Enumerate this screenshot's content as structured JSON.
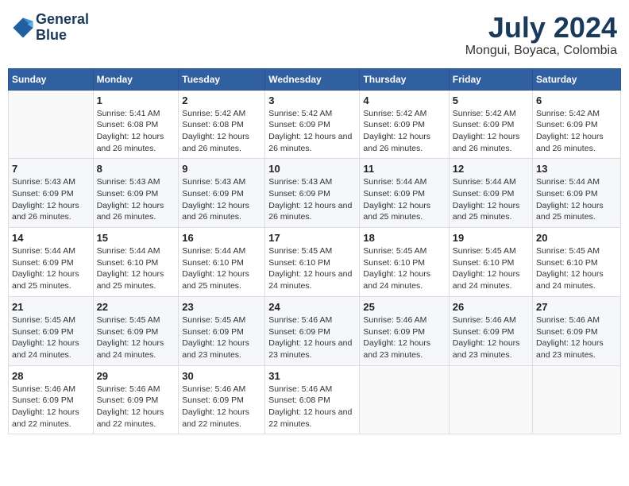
{
  "header": {
    "logo_line1": "General",
    "logo_line2": "Blue",
    "month_year": "July 2024",
    "location": "Mongui, Boyaca, Colombia"
  },
  "days_of_week": [
    "Sunday",
    "Monday",
    "Tuesday",
    "Wednesday",
    "Thursday",
    "Friday",
    "Saturday"
  ],
  "weeks": [
    [
      {
        "day": "",
        "sunrise": "",
        "sunset": "",
        "daylight": ""
      },
      {
        "day": "1",
        "sunrise": "Sunrise: 5:41 AM",
        "sunset": "Sunset: 6:08 PM",
        "daylight": "Daylight: 12 hours and 26 minutes."
      },
      {
        "day": "2",
        "sunrise": "Sunrise: 5:42 AM",
        "sunset": "Sunset: 6:08 PM",
        "daylight": "Daylight: 12 hours and 26 minutes."
      },
      {
        "day": "3",
        "sunrise": "Sunrise: 5:42 AM",
        "sunset": "Sunset: 6:09 PM",
        "daylight": "Daylight: 12 hours and 26 minutes."
      },
      {
        "day": "4",
        "sunrise": "Sunrise: 5:42 AM",
        "sunset": "Sunset: 6:09 PM",
        "daylight": "Daylight: 12 hours and 26 minutes."
      },
      {
        "day": "5",
        "sunrise": "Sunrise: 5:42 AM",
        "sunset": "Sunset: 6:09 PM",
        "daylight": "Daylight: 12 hours and 26 minutes."
      },
      {
        "day": "6",
        "sunrise": "Sunrise: 5:42 AM",
        "sunset": "Sunset: 6:09 PM",
        "daylight": "Daylight: 12 hours and 26 minutes."
      }
    ],
    [
      {
        "day": "7",
        "sunrise": "Sunrise: 5:43 AM",
        "sunset": "Sunset: 6:09 PM",
        "daylight": "Daylight: 12 hours and 26 minutes."
      },
      {
        "day": "8",
        "sunrise": "Sunrise: 5:43 AM",
        "sunset": "Sunset: 6:09 PM",
        "daylight": "Daylight: 12 hours and 26 minutes."
      },
      {
        "day": "9",
        "sunrise": "Sunrise: 5:43 AM",
        "sunset": "Sunset: 6:09 PM",
        "daylight": "Daylight: 12 hours and 26 minutes."
      },
      {
        "day": "10",
        "sunrise": "Sunrise: 5:43 AM",
        "sunset": "Sunset: 6:09 PM",
        "daylight": "Daylight: 12 hours and 26 minutes."
      },
      {
        "day": "11",
        "sunrise": "Sunrise: 5:44 AM",
        "sunset": "Sunset: 6:09 PM",
        "daylight": "Daylight: 12 hours and 25 minutes."
      },
      {
        "day": "12",
        "sunrise": "Sunrise: 5:44 AM",
        "sunset": "Sunset: 6:09 PM",
        "daylight": "Daylight: 12 hours and 25 minutes."
      },
      {
        "day": "13",
        "sunrise": "Sunrise: 5:44 AM",
        "sunset": "Sunset: 6:09 PM",
        "daylight": "Daylight: 12 hours and 25 minutes."
      }
    ],
    [
      {
        "day": "14",
        "sunrise": "Sunrise: 5:44 AM",
        "sunset": "Sunset: 6:09 PM",
        "daylight": "Daylight: 12 hours and 25 minutes."
      },
      {
        "day": "15",
        "sunrise": "Sunrise: 5:44 AM",
        "sunset": "Sunset: 6:10 PM",
        "daylight": "Daylight: 12 hours and 25 minutes."
      },
      {
        "day": "16",
        "sunrise": "Sunrise: 5:44 AM",
        "sunset": "Sunset: 6:10 PM",
        "daylight": "Daylight: 12 hours and 25 minutes."
      },
      {
        "day": "17",
        "sunrise": "Sunrise: 5:45 AM",
        "sunset": "Sunset: 6:10 PM",
        "daylight": "Daylight: 12 hours and 24 minutes."
      },
      {
        "day": "18",
        "sunrise": "Sunrise: 5:45 AM",
        "sunset": "Sunset: 6:10 PM",
        "daylight": "Daylight: 12 hours and 24 minutes."
      },
      {
        "day": "19",
        "sunrise": "Sunrise: 5:45 AM",
        "sunset": "Sunset: 6:10 PM",
        "daylight": "Daylight: 12 hours and 24 minutes."
      },
      {
        "day": "20",
        "sunrise": "Sunrise: 5:45 AM",
        "sunset": "Sunset: 6:10 PM",
        "daylight": "Daylight: 12 hours and 24 minutes."
      }
    ],
    [
      {
        "day": "21",
        "sunrise": "Sunrise: 5:45 AM",
        "sunset": "Sunset: 6:09 PM",
        "daylight": "Daylight: 12 hours and 24 minutes."
      },
      {
        "day": "22",
        "sunrise": "Sunrise: 5:45 AM",
        "sunset": "Sunset: 6:09 PM",
        "daylight": "Daylight: 12 hours and 24 minutes."
      },
      {
        "day": "23",
        "sunrise": "Sunrise: 5:45 AM",
        "sunset": "Sunset: 6:09 PM",
        "daylight": "Daylight: 12 hours and 23 minutes."
      },
      {
        "day": "24",
        "sunrise": "Sunrise: 5:46 AM",
        "sunset": "Sunset: 6:09 PM",
        "daylight": "Daylight: 12 hours and 23 minutes."
      },
      {
        "day": "25",
        "sunrise": "Sunrise: 5:46 AM",
        "sunset": "Sunset: 6:09 PM",
        "daylight": "Daylight: 12 hours and 23 minutes."
      },
      {
        "day": "26",
        "sunrise": "Sunrise: 5:46 AM",
        "sunset": "Sunset: 6:09 PM",
        "daylight": "Daylight: 12 hours and 23 minutes."
      },
      {
        "day": "27",
        "sunrise": "Sunrise: 5:46 AM",
        "sunset": "Sunset: 6:09 PM",
        "daylight": "Daylight: 12 hours and 23 minutes."
      }
    ],
    [
      {
        "day": "28",
        "sunrise": "Sunrise: 5:46 AM",
        "sunset": "Sunset: 6:09 PM",
        "daylight": "Daylight: 12 hours and 22 minutes."
      },
      {
        "day": "29",
        "sunrise": "Sunrise: 5:46 AM",
        "sunset": "Sunset: 6:09 PM",
        "daylight": "Daylight: 12 hours and 22 minutes."
      },
      {
        "day": "30",
        "sunrise": "Sunrise: 5:46 AM",
        "sunset": "Sunset: 6:09 PM",
        "daylight": "Daylight: 12 hours and 22 minutes."
      },
      {
        "day": "31",
        "sunrise": "Sunrise: 5:46 AM",
        "sunset": "Sunset: 6:08 PM",
        "daylight": "Daylight: 12 hours and 22 minutes."
      },
      {
        "day": "",
        "sunrise": "",
        "sunset": "",
        "daylight": ""
      },
      {
        "day": "",
        "sunrise": "",
        "sunset": "",
        "daylight": ""
      },
      {
        "day": "",
        "sunrise": "",
        "sunset": "",
        "daylight": ""
      }
    ]
  ]
}
